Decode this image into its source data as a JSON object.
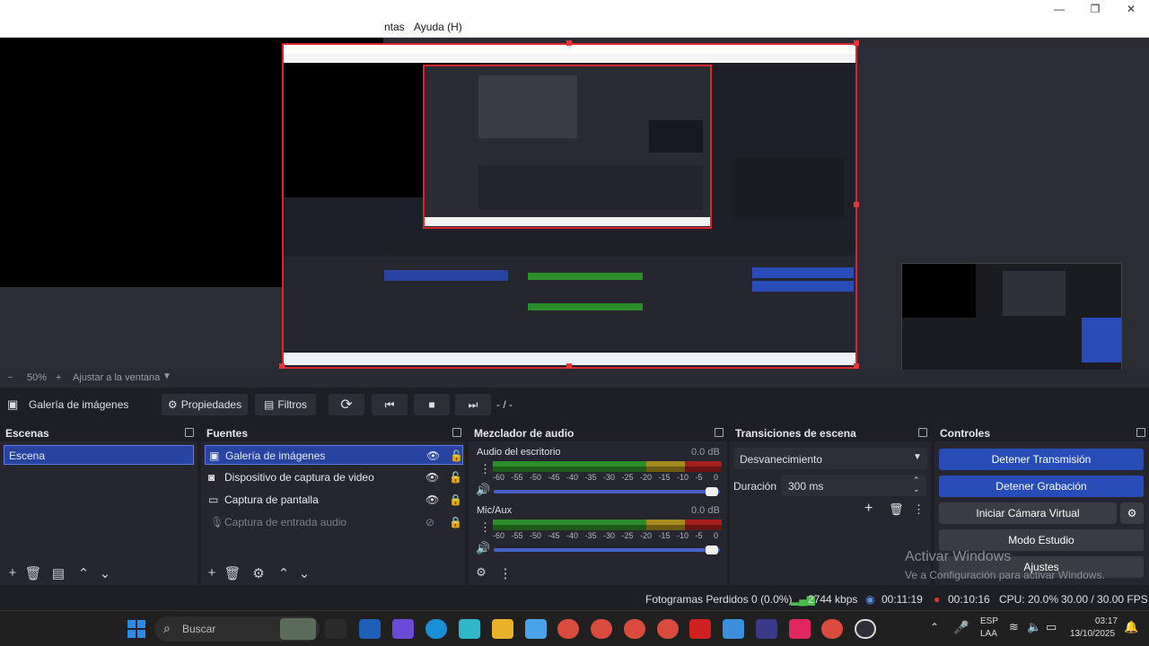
{
  "window": {
    "minimize": "—",
    "maximize": "❐",
    "close": "✕"
  },
  "menu": {
    "partial_item": "ntas",
    "help": "Ayuda (H)"
  },
  "zoom": {
    "minus": "−",
    "value": "50%",
    "plus": "+",
    "fit_label": "Ajustar a la ventana"
  },
  "source_toolbar": {
    "source_name": "Galería de imágenes",
    "properties": "Propiedades",
    "filters": "Filtros",
    "time": "- / -"
  },
  "scenes": {
    "title": "Escenas",
    "items": [
      "Escena"
    ]
  },
  "sources": {
    "title": "Fuentes",
    "items": [
      {
        "label": "Galería de imágenes",
        "icon": "image-icon",
        "visible": true,
        "locked": false,
        "selected": true
      },
      {
        "label": "Dispositivo de captura de video",
        "icon": "camera-icon",
        "visible": true,
        "locked": false,
        "selected": false
      },
      {
        "label": "Captura de pantalla",
        "icon": "monitor-icon",
        "visible": true,
        "locked": true,
        "selected": false
      },
      {
        "label": "Captura de entrada audio",
        "icon": "mic-icon",
        "visible": false,
        "locked": true,
        "selected": false
      }
    ]
  },
  "mixer": {
    "title": "Mezclador de audio",
    "channels": [
      {
        "name": "Audio del escritorio",
        "db": "0.0 dB",
        "volume": 1.0
      },
      {
        "name": "Mic/Aux",
        "db": "0.0 dB",
        "volume": 1.0
      }
    ],
    "scale": [
      "-60",
      "-55",
      "-50",
      "-45",
      "-40",
      "-35",
      "-30",
      "-25",
      "-20",
      "-15",
      "-10",
      "-5",
      "0"
    ]
  },
  "transitions": {
    "title": "Transiciones de escena",
    "selected": "Desvanecimiento",
    "duration_label": "Duración",
    "duration_value": "300 ms"
  },
  "controls": {
    "title": "Controles",
    "stop_stream": "Detener Transmisión",
    "stop_record": "Detener Grabación",
    "virtual_cam": "Iniciar Cámara Virtual",
    "studio_mode": "Modo Estudio",
    "settings": "Ajustes"
  },
  "watermark": {
    "line1": "Activar Windows",
    "line2": "Ve a Configuración para activar Windows."
  },
  "status": {
    "dropped": "Fotogramas Perdidos 0 (0.0%)",
    "bitrate": "2744 kbps",
    "stream_time": "00:11:19",
    "rec_time": "00:10:16",
    "cpu": "CPU: 20.0%",
    "fps": "30.00 / 30.00 FPS"
  },
  "taskbar": {
    "search_placeholder": "Buscar",
    "lang1": "ESP",
    "lang2": "LAA",
    "time": "03:17",
    "date": "13/10/2025"
  },
  "colors": {
    "accent_blue": "#284cb8",
    "selection_red": "#d8262a",
    "panel_bg": "#26272e"
  }
}
